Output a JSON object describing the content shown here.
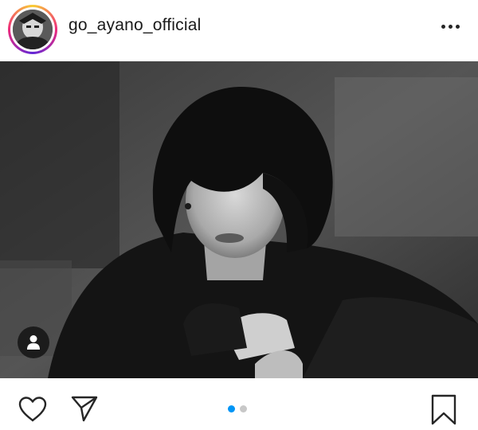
{
  "post": {
    "username": "go_ayano_official",
    "avatar_icon": "profile-avatar",
    "more_icon": "more-options-icon",
    "photo_description_icon": "black-and-white-portrait-photo",
    "user_tag_icon": "person-icon"
  },
  "actions": {
    "like_icon": "heart-icon",
    "share_icon": "send-icon",
    "save_icon": "bookmark-icon"
  },
  "carousel": {
    "current": 1,
    "total": 2,
    "active_color": "#0095f6",
    "inactive_color": "#c8c8c8"
  },
  "colors": {
    "story_ring_start": "#f9ce34",
    "story_ring_mid": "#ee2a7b",
    "story_ring_end": "#6228d7"
  }
}
